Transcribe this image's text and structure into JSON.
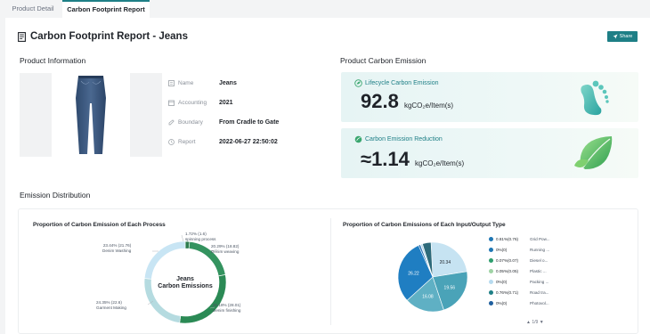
{
  "tabs": [
    {
      "label": "Product Detail",
      "active": false
    },
    {
      "label": "Carbon Footprint Report",
      "active": true
    }
  ],
  "header": {
    "title": "Carbon Footprint Report - Jeans",
    "share_label": "Share",
    "accent": "#1e7f86"
  },
  "product_info": {
    "section_title": "Product Information",
    "rows": [
      {
        "icon": "tag-icon",
        "label": "Name",
        "value": "Jeans"
      },
      {
        "icon": "calendar-icon",
        "label": "Accounting",
        "value": "2021"
      },
      {
        "icon": "boundary-icon",
        "label": "Boundary",
        "value": "From Cradle to Gate"
      },
      {
        "icon": "clock-icon",
        "label": "Report",
        "value": "2022-06-27 22:50:02"
      }
    ]
  },
  "emission": {
    "section_title": "Product Carbon Emission",
    "lifecycle": {
      "caption": "Lifecycle Carbon Emission",
      "value": "92.8",
      "unit": "kgCO₂e/Item(s)"
    },
    "reduction": {
      "caption": "Carbon Emission Reduction",
      "value": "≈1.14",
      "unit": "kgCO₂e/Item(s)"
    }
  },
  "distribution": {
    "section_title": "Emission Distribution",
    "process_chart_title": "Proportion of Carbon Emission of Each Process",
    "io_chart_title": "Proportion of Carbon Emissions of Each Input/Output Type",
    "pager": "1/9"
  },
  "chart_data": [
    {
      "type": "pie",
      "title": "Proportion of Carbon Emission of Each Process",
      "center_label": [
        "Jeans",
        "Carbon Emissions"
      ],
      "categories": [
        "spinning process",
        "Denim weaving",
        "Denim finishing",
        "Garment Making",
        "Denim Washing"
      ],
      "values": [
        1.6,
        18.82,
        28.01,
        22.6,
        21.76
      ],
      "percents": [
        1.72,
        20.29,
        30.18,
        24.35,
        23.44
      ],
      "labels": [
        "1.72% (1.6)\nspinning process",
        "20.29% (18.82)\nDenim weaving",
        "30.18% (28.01)\nDenim finishing",
        "24.35% (22.6)\nGarment Making",
        "23.44% (21.76)\nDenim Washing"
      ],
      "colors": [
        "#2e7d4f",
        "#2e8b57",
        "#2e8b57",
        "#b9dde0",
        "#c6e3f2"
      ]
    },
    {
      "type": "pie",
      "title": "Proportion of Carbon Emissions of Each Input/Output Type",
      "values": [
        20.34,
        19.56,
        16.08,
        26.22,
        0.81,
        0.07,
        0.05,
        0.76,
        3.5
      ],
      "slice_labels": [
        "20.34",
        "19.56",
        "16.08",
        "26.22",
        "",
        "",
        "",
        "",
        ""
      ],
      "colors": [
        "#c6e3f2",
        "#4aa3b8",
        "#5fb0c4",
        "#1f7ec2",
        "#2a73b5",
        "#1e7f86",
        "#3aa66f",
        "#b3d6ea",
        "#2d6a7a"
      ],
      "legend": [
        {
          "pct": "0.81%(0.76)",
          "name": "Grid Pow...",
          "color": "#1f77b4"
        },
        {
          "pct": "0%(0)",
          "name": "Running ...",
          "color": "#1f77b4"
        },
        {
          "pct": "0.07%(0.07)",
          "name": "Diesel o...",
          "color": "#2e9e6e"
        },
        {
          "pct": "0.05%(0.05)",
          "name": "Plastic ...",
          "color": "#9fd3a5"
        },
        {
          "pct": "0%(0)",
          "name": "Packing ...",
          "color": "#b7dbef"
        },
        {
          "pct": "0.76%(0.71)",
          "name": "Road tra...",
          "color": "#1e7f86"
        },
        {
          "pct": "0%(0)",
          "name": "Photovol...",
          "color": "#1f5f9e"
        }
      ]
    }
  ]
}
